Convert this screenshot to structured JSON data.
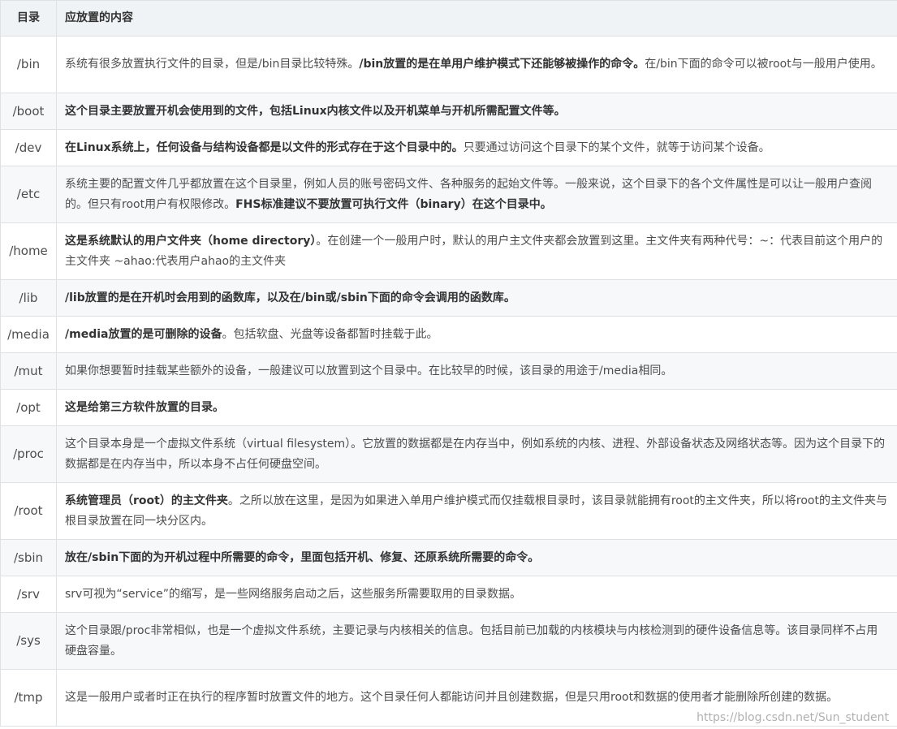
{
  "table": {
    "headers": {
      "dir": "目录",
      "content": "应放置的内容"
    },
    "rows": [
      {
        "dir": "/bin",
        "desc": [
          {
            "t": "系统有很多放置执行文件的目录，但是/bin目录比较特殊。",
            "b": false
          },
          {
            "t": "/bin放置的是在单用户维护模式下还能够被操作的命令。",
            "b": true
          },
          {
            "t": "在/bin下面的命令可以被root与一般用户使用。",
            "b": false
          }
        ]
      },
      {
        "dir": "/boot",
        "desc": [
          {
            "t": "这个目录主要放置开机会使用到的文件，包括Linux内核文件以及开机菜单与开机所需配置文件等。",
            "b": true
          }
        ]
      },
      {
        "dir": "/dev",
        "desc": [
          {
            "t": "在Linux系统上，任何设备与结构设备都是以文件的形式存在于这个目录中的。",
            "b": true
          },
          {
            "t": "只要通过访问这个目录下的某个文件，就等于访问某个设备。",
            "b": false
          }
        ]
      },
      {
        "dir": "/etc",
        "desc": [
          {
            "t": "系统主要的配置文件几乎都放置在这个目录里，例如人员的账号密码文件、各种服务的起始文件等。一般来说，这个目录下的各个文件属性是可以让一般用户查阅的。但只有root用户有权限修改。",
            "b": false
          },
          {
            "t": "FHS标准建议不要放置可执行文件（binary）在这个目录中。",
            "b": true
          }
        ]
      },
      {
        "dir": "/home",
        "desc": [
          {
            "t": "这是系统默认的用户文件夹（home directory）",
            "b": true
          },
          {
            "t": "。在创建一个一般用户时，默认的用户主文件夹都会放置到这里。主文件夹有两种代号：~：代表目前这个用户的主文件夹 ~ahao:代表用户ahao的主文件夹",
            "b": false
          }
        ]
      },
      {
        "dir": "/lib",
        "desc": [
          {
            "t": "/lib放置的是在开机时会用到的函数库，以及在/bin或/sbin下面的命令会调用的函数库。",
            "b": true
          }
        ]
      },
      {
        "dir": "/media",
        "desc": [
          {
            "t": "/media放置的是可删除的设备",
            "b": true
          },
          {
            "t": "。包括软盘、光盘等设备都暂时挂载于此。",
            "b": false
          }
        ]
      },
      {
        "dir": "/mut",
        "desc": [
          {
            "t": "如果你想要暂时挂载某些额外的设备，一般建议可以放置到这个目录中。在比较早的时候，该目录的用途于/media相同。",
            "b": false
          }
        ]
      },
      {
        "dir": "/opt",
        "desc": [
          {
            "t": "这是给第三方软件放置的目录。",
            "b": true
          }
        ]
      },
      {
        "dir": "/proc",
        "desc": [
          {
            "t": "这个目录本身是一个虚拟文件系统（virtual filesystem）。它放置的数据都是在内存当中，例如系统的内核、进程、外部设备状态及网络状态等。因为这个目录下的数据都是在内存当中，所以本身不占任何硬盘空间。",
            "b": false
          }
        ]
      },
      {
        "dir": "/root",
        "desc": [
          {
            "t": "系统管理员（root）的主文件夹",
            "b": true
          },
          {
            "t": "。之所以放在这里，是因为如果进入单用户维护模式而仅挂载根目录时，该目录就能拥有root的主文件夹，所以将root的主文件夹与根目录放置在同一块分区内。",
            "b": false
          }
        ]
      },
      {
        "dir": "/sbin",
        "desc": [
          {
            "t": "放在/sbin下面的为开机过程中所需要的命令，里面包括开机、修复、还原系统所需要的命令。",
            "b": true
          }
        ]
      },
      {
        "dir": "/srv",
        "desc": [
          {
            "t": "srv可视为“service”的缩写，是一些网络服务启动之后，这些服务所需要取用的目录数据。",
            "b": false
          }
        ]
      },
      {
        "dir": "/sys",
        "desc": [
          {
            "t": "这个目录跟/proc非常相似，也是一个虚拟文件系统，主要记录与内核相关的信息。包括目前已加载的内核模块与内核检测到的硬件设备信息等。该目录同样不占用硬盘容量。",
            "b": false
          }
        ]
      },
      {
        "dir": "/tmp",
        "desc": [
          {
            "t": "这是一般用户或者时正在执行的程序暂时放置文件的地方。这个目录任何人都能访问并且创建数据，但是只用root和数据的使用者才能删除所创建的数据。",
            "b": false
          }
        ]
      }
    ]
  },
  "watermark": "https://blog.csdn.net/Sun_student"
}
